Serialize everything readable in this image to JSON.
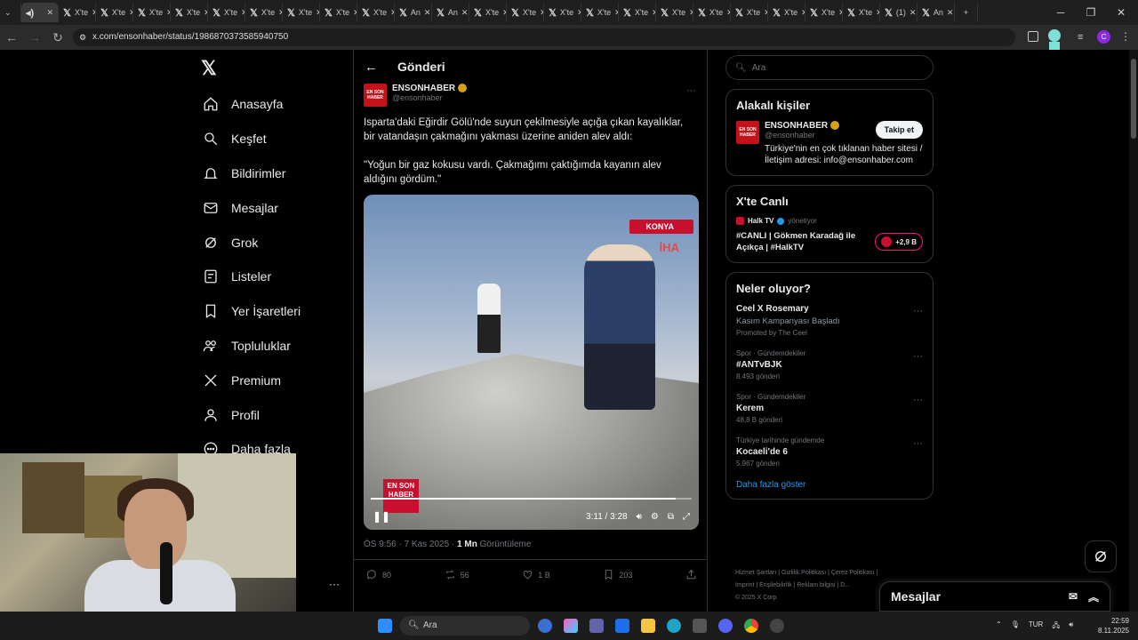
{
  "browser": {
    "tabs": [
      {
        "label": ""
      },
      {
        "label": "X'te"
      },
      {
        "label": "X'te"
      },
      {
        "label": "X'te"
      },
      {
        "label": "X'te"
      },
      {
        "label": "X'te"
      },
      {
        "label": "X'te"
      },
      {
        "label": "X'te"
      },
      {
        "label": "X'te"
      },
      {
        "label": "X'te"
      },
      {
        "label": "An"
      },
      {
        "label": "An"
      },
      {
        "label": "X'te"
      },
      {
        "label": "X'te"
      },
      {
        "label": "X'te"
      },
      {
        "label": "X'te"
      },
      {
        "label": "X'te"
      },
      {
        "label": "X'te"
      },
      {
        "label": "X'te"
      },
      {
        "label": "X'te"
      },
      {
        "label": "X'te"
      },
      {
        "label": "X'te"
      },
      {
        "label": "X'te"
      },
      {
        "label": "(1)"
      },
      {
        "label": "An"
      }
    ],
    "url": "x.com/ensonhaber/status/1986870373585940750",
    "profile_initial": "C"
  },
  "nav": {
    "items": [
      {
        "label": "Anasayfa",
        "icon": "home-icon"
      },
      {
        "label": "Keşfet",
        "icon": "search-icon"
      },
      {
        "label": "Bildirimler",
        "icon": "bell-icon"
      },
      {
        "label": "Mesajlar",
        "icon": "mail-icon"
      },
      {
        "label": "Grok",
        "icon": "grok-icon"
      },
      {
        "label": "Listeler",
        "icon": "list-icon"
      },
      {
        "label": "Yer İşaretleri",
        "icon": "bookmark-icon"
      },
      {
        "label": "Topluluklar",
        "icon": "community-icon"
      },
      {
        "label": "Premium",
        "icon": "x-icon"
      },
      {
        "label": "Profil",
        "icon": "user-icon"
      },
      {
        "label": "Daha fazla",
        "icon": "more-icon"
      }
    ]
  },
  "post": {
    "header_title": "Gönderi",
    "author_name": "ENSONHABER",
    "author_handle": "@ensonhaber",
    "avatar_text": "EN SON HABER",
    "text_1": "Isparta'daki Eğirdir Gölü'nde suyun çekilmesiyle açığa çıkan kayalıklar, bir vatandaşın çakmağını yakması üzerine aniden alev aldı:",
    "text_2": "\"Yoğun bir gaz kokusu vardı. Çakmağımı çaktığımda kayanın alev aldığını gördüm.\"",
    "video": {
      "location_badge": "KONYA",
      "agency": "İHA",
      "logo_text": "EN SON HABER",
      "time": "3:11 / 3:28",
      "progress": 0.95
    },
    "time_meta": "ÖS 9:56 · 7 Kas 2025 · ",
    "views_count": "1 Mn",
    "views_label": " Görüntüleme",
    "replies": "80",
    "reposts": "56",
    "likes": "1 B",
    "bookmarks": "203"
  },
  "sidebar": {
    "search_placeholder": "Ara",
    "related": {
      "title": "Alakalı kişiler",
      "name": "ENSONHABER",
      "handle": "@ensonhaber",
      "follow_label": "Takip et",
      "bio": "Türkiye'nin en çok tıklanan haber sitesi / İletişim adresi: info@ensonhaber.com"
    },
    "live": {
      "title": "X'te Canlı",
      "host": "Halk TV",
      "host_status": "yönetiyor",
      "stream_title": "#CANLI | Gökmen Karadağ ile Açıkça | #HalkTV",
      "listeners": "+2,9 B"
    },
    "trends": {
      "title": "Neler oluyor?",
      "items": [
        {
          "context": "",
          "name": "Ceel X Rosemary",
          "sub": "Kasım Kampanyası Başladı",
          "meta": "Promoted by The Ceel"
        },
        {
          "context": "Spor · Gündemdekiler",
          "name": "#ANTvBJK",
          "sub": "",
          "meta": "8.493 gönderi"
        },
        {
          "context": "Spor · Gündemdekiler",
          "name": "Kerem",
          "sub": "",
          "meta": "48,8 B gönderi"
        },
        {
          "context": "Türkiye tarihinde gündemde",
          "name": "Kocaeli'de 6",
          "sub": "",
          "meta": "5.967 gönderi"
        }
      ],
      "show_more": "Daha fazla göster"
    },
    "footer": {
      "line1": "Hizmet Şartları  |  Gizlilik Politikası  |  Çerez Politikası  |",
      "line2": "Imprint  |  Erişilebilirlik  |  Reklam bilgisi  |  D...",
      "copyright": "© 2025 X Corp."
    }
  },
  "messages_bar": {
    "label": "Mesajlar"
  },
  "taskbar": {
    "search_label": "Ara",
    "lang": "TUR",
    "time": "22:59",
    "date": "8.11.2025"
  }
}
